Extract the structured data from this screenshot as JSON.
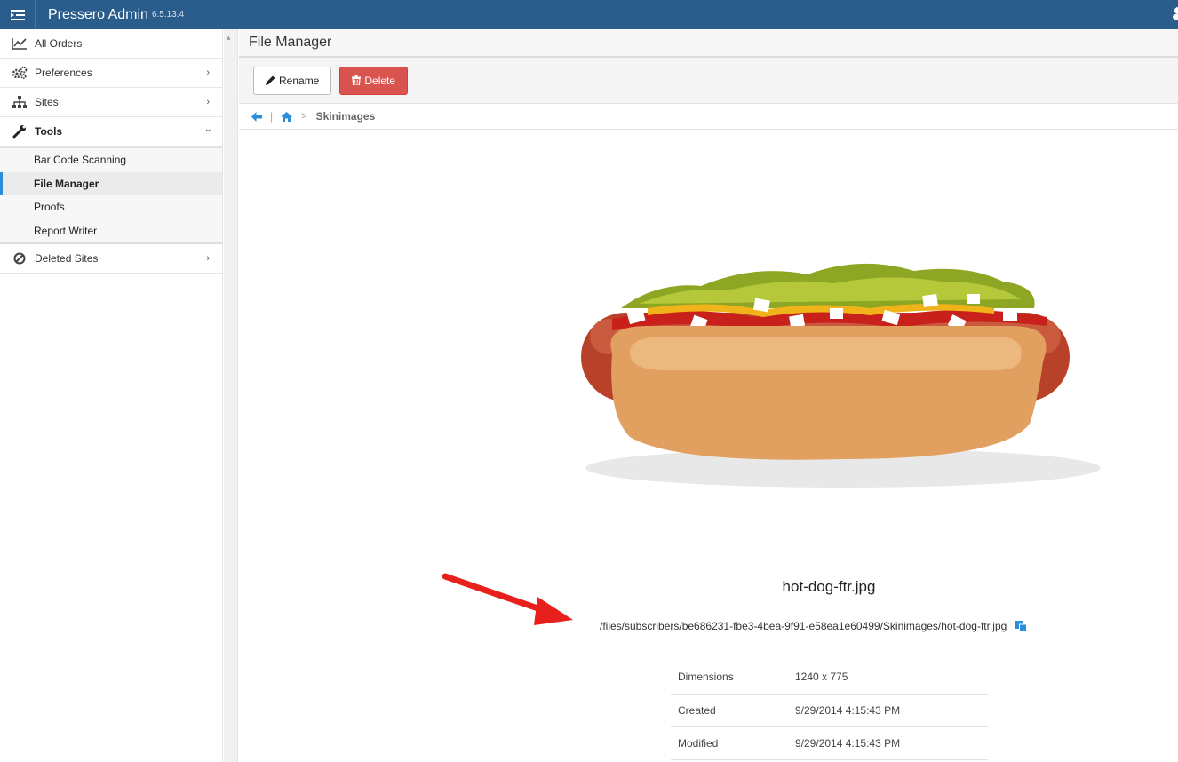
{
  "app": {
    "title": "Pressero Admin",
    "version": "6.5.13.4"
  },
  "sidebar": {
    "items": [
      {
        "label": "All Orders",
        "icon": "line-chart-icon"
      },
      {
        "label": "Preferences",
        "icon": "gears-icon"
      },
      {
        "label": "Sites",
        "icon": "sitemap-icon"
      },
      {
        "label": "Tools",
        "icon": "wrench-icon"
      }
    ],
    "tools_sub": [
      {
        "label": "Bar Code Scanning"
      },
      {
        "label": "File Manager"
      },
      {
        "label": "Proofs"
      },
      {
        "label": "Report Writer"
      }
    ],
    "deleted": {
      "label": "Deleted Sites",
      "icon": "ban-icon"
    }
  },
  "page": {
    "title": "File Manager"
  },
  "toolbar": {
    "rename_label": "Rename",
    "delete_label": "Delete"
  },
  "breadcrumb": {
    "current": "Skinimages"
  },
  "file": {
    "name": "hot-dog-ftr.jpg",
    "path": "/files/subscribers/be686231-fbe3-4bea-9f91-e58ea1e60499/Skinimages/hot-dog-ftr.jpg",
    "properties": [
      {
        "key": "Dimensions",
        "value": "1240 x 775"
      },
      {
        "key": "Created",
        "value": "9/29/2014 4:15:43 PM"
      },
      {
        "key": "Modified",
        "value": "9/29/2014 4:15:43 PM"
      }
    ]
  },
  "colors": {
    "header": "#2b5d8c",
    "delete": "#d9534f",
    "accent": "#2b8ed8",
    "annotation_arrow": "#e8201c"
  }
}
